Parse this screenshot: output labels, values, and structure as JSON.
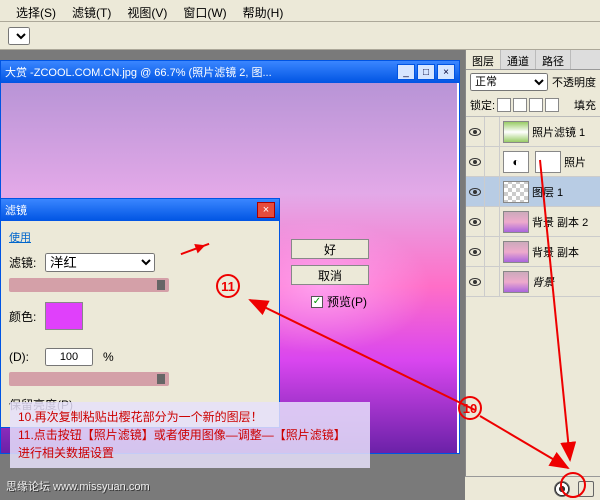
{
  "menu": {
    "items": [
      "选择(S)",
      "滤镜(T)",
      "视图(V)",
      "窗口(W)",
      "帮助(H)"
    ]
  },
  "doc": {
    "title": "大赏 -ZCOOL.COM.CN.jpg @ 66.7% (照片滤镜 2, 图...",
    "winbtn": {
      "min": "_",
      "max": "□",
      "close": "×"
    }
  },
  "dialog": {
    "title": "滤镜",
    "tab": "使用",
    "filter_label": "滤镜:",
    "filter_value": "洋红",
    "color_label": "颜色:",
    "density_label": "(D):",
    "density_value": "100",
    "density_unit": "%",
    "preserve_label": "保留亮度(P)",
    "ok": "好",
    "cancel": "取消",
    "preview": "预览(P)"
  },
  "panels": {
    "tabs": [
      "图层",
      "通道",
      "路径"
    ],
    "blend_value": "正常",
    "opacity_label": "不透明度",
    "lock_label": "锁定:",
    "fill_label": "填充",
    "layers": [
      {
        "name": "照片滤镜 1"
      },
      {
        "name": "照片"
      },
      {
        "name": "图层 1"
      },
      {
        "name": "背景 副本 2"
      },
      {
        "name": "背景 副本"
      },
      {
        "name": "背景"
      }
    ]
  },
  "annotations": {
    "c10": "10",
    "c11": "11",
    "lines": [
      "10.再次复制粘贴出樱花部分为一个新的图层！",
      "11.点击按钮【照片滤镜】或者使用图像—调整—【照片滤镜】",
      "   进行相关数据设置"
    ],
    "footer": "思缘论坛   www.missyuan.com"
  }
}
